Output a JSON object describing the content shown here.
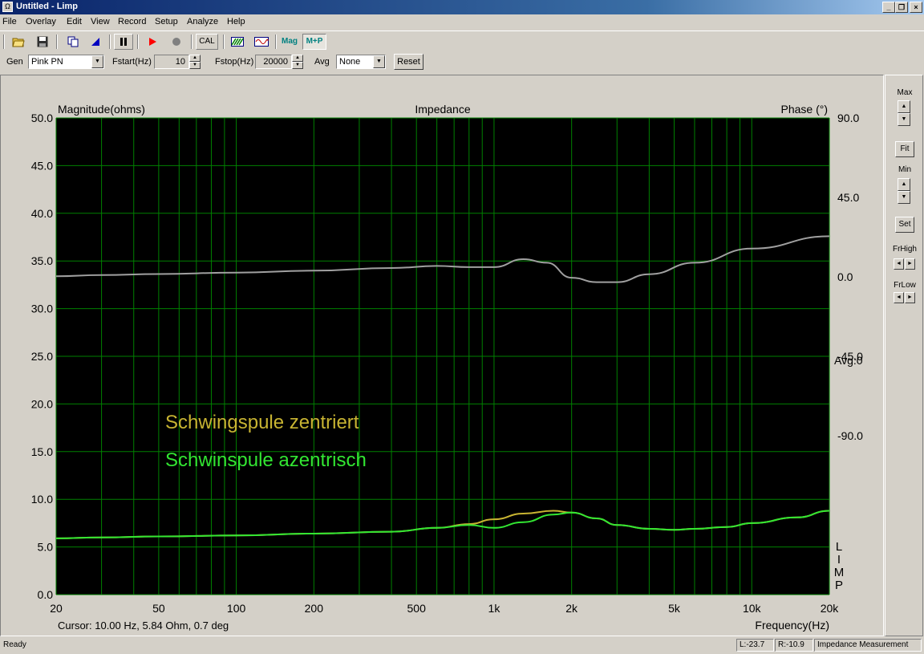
{
  "window": {
    "title": "Untitled - Limp",
    "app_icon": "limp-app-icon"
  },
  "menu": [
    {
      "label": "File",
      "x": 3
    },
    {
      "label": "Overlay",
      "x": 32
    },
    {
      "label": "Edit",
      "x": 83
    },
    {
      "label": "View",
      "x": 113
    },
    {
      "label": "Record",
      "x": 147
    },
    {
      "label": "Setup",
      "x": 193
    },
    {
      "label": "Analyze",
      "x": 233
    },
    {
      "label": "Help",
      "x": 283
    }
  ],
  "toolbar": {
    "cal_label": "CAL",
    "mag_label": "Mag",
    "mp_label": "M+P",
    "colors": {
      "play": "#ff0000",
      "record": "#808080",
      "mag": "#008080"
    }
  },
  "controls": {
    "gen_label": "Gen",
    "gen_value": "Pink PN",
    "fstart_label": "Fstart(Hz)",
    "fstart_value": "10",
    "fstop_label": "Fstop(Hz)",
    "fstop_value": "20000",
    "avg_label": "Avg",
    "avg_value": "None",
    "reset_label": "Reset"
  },
  "side": {
    "max_label": "Max",
    "fit_label": "Fit",
    "min_label": "Min",
    "set_label": "Set",
    "frhigh_label": "FrHigh",
    "frlow_label": "FrLow"
  },
  "chart_data": {
    "type": "line",
    "title": "Impedance",
    "ylabel": "Magnitude(ohms)",
    "y2label": "Phase (°)",
    "xlabel": "Frequency(Hz)",
    "xscale": "log",
    "xlim": [
      20,
      20000
    ],
    "ylim": [
      0,
      50
    ],
    "y2lim": [
      -180,
      90
    ],
    "xticks": [
      20,
      50,
      100,
      200,
      500,
      1000,
      2000,
      5000,
      10000,
      20000
    ],
    "xtick_labels": [
      "20",
      "50",
      "100",
      "200",
      "500",
      "1k",
      "2k",
      "5k",
      "10k",
      "20k"
    ],
    "yticks": [
      0,
      5,
      10,
      15,
      20,
      25,
      30,
      35,
      40,
      45,
      50
    ],
    "ytick_labels": [
      "0.0",
      "5.0",
      "10.0",
      "15.0",
      "20.0",
      "25.0",
      "30.0",
      "35.0",
      "40.0",
      "45.0",
      "50.0"
    ],
    "y2ticks": [
      90,
      45,
      0,
      -45,
      -90
    ],
    "y2tick_labels": [
      "90.0",
      "45.0",
      "0.0",
      "-45.0",
      "-90.0"
    ],
    "grid": true,
    "background": "#000000",
    "grid_color": "#008000",
    "avg_text": "Avg:0",
    "side_tag": [
      "L",
      "I",
      "M",
      "P"
    ],
    "cursor_text": "Cursor: 10.00 Hz, 5.84 Ohm, 0.7 deg",
    "annotations": [
      {
        "text": "Schwingspule zentriert",
        "color": "#c8b432"
      },
      {
        "text": "Schwinspule azentrisch",
        "color": "#32e632"
      }
    ],
    "series": [
      {
        "axis": "phase",
        "color": "#a0a0a0",
        "x": [
          20,
          30,
          50,
          100,
          200,
          400,
          600,
          800,
          1000,
          1300,
          1600,
          2000,
          2500,
          3000,
          4000,
          6000,
          10000,
          20000
        ],
        "y": [
          0.3,
          1.0,
          1.6,
          2.4,
          3.5,
          5.0,
          6.2,
          5.5,
          5.5,
          10.0,
          8.0,
          -0.5,
          -3.0,
          -3.0,
          1.5,
          8.0,
          16.0,
          23.0
        ]
      },
      {
        "axis": "magnitude",
        "color": "#c8b432",
        "x": [
          20,
          30,
          50,
          100,
          200,
          400,
          600,
          800,
          1000,
          1300,
          1700,
          2000,
          2500,
          3000,
          4000,
          5000,
          6000,
          8000,
          10000,
          15000,
          20000
        ],
        "y": [
          5.9,
          6.0,
          6.1,
          6.2,
          6.4,
          6.6,
          7.0,
          7.4,
          7.9,
          8.5,
          8.8,
          8.6,
          8.0,
          7.3,
          6.9,
          6.8,
          6.9,
          7.1,
          7.5,
          8.1,
          8.8
        ]
      },
      {
        "axis": "magnitude",
        "color": "#32e632",
        "x": [
          20,
          30,
          50,
          100,
          200,
          400,
          600,
          800,
          1000,
          1300,
          1700,
          2000,
          2500,
          3000,
          4000,
          5000,
          6000,
          8000,
          10000,
          15000,
          20000
        ],
        "y": [
          5.9,
          6.0,
          6.1,
          6.2,
          6.4,
          6.6,
          7.0,
          7.3,
          7.0,
          7.6,
          8.4,
          8.6,
          8.0,
          7.3,
          6.9,
          6.8,
          6.9,
          7.1,
          7.5,
          8.1,
          8.8
        ]
      }
    ]
  },
  "status": {
    "ready": "Ready",
    "left": "L:-23.7",
    "right": "R:-10.9",
    "mode": "Impedance Measurement"
  }
}
